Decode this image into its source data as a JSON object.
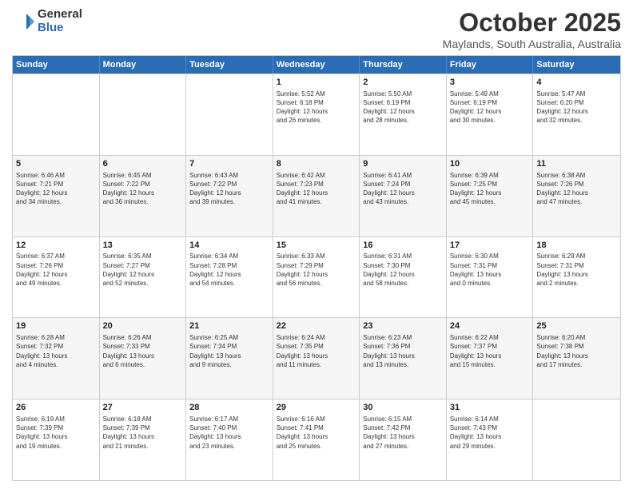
{
  "logo": {
    "general": "General",
    "blue": "Blue"
  },
  "header": {
    "month": "October 2025",
    "location": "Maylands, South Australia, Australia"
  },
  "weekdays": [
    "Sunday",
    "Monday",
    "Tuesday",
    "Wednesday",
    "Thursday",
    "Friday",
    "Saturday"
  ],
  "rows": [
    [
      {
        "day": "",
        "info": ""
      },
      {
        "day": "",
        "info": ""
      },
      {
        "day": "",
        "info": ""
      },
      {
        "day": "1",
        "info": "Sunrise: 5:52 AM\nSunset: 6:18 PM\nDaylight: 12 hours\nand 26 minutes."
      },
      {
        "day": "2",
        "info": "Sunrise: 5:50 AM\nSunset: 6:19 PM\nDaylight: 12 hours\nand 28 minutes."
      },
      {
        "day": "3",
        "info": "Sunrise: 5:49 AM\nSunset: 6:19 PM\nDaylight: 12 hours\nand 30 minutes."
      },
      {
        "day": "4",
        "info": "Sunrise: 5:47 AM\nSunset: 6:20 PM\nDaylight: 12 hours\nand 32 minutes."
      }
    ],
    [
      {
        "day": "5",
        "info": "Sunrise: 6:46 AM\nSunset: 7:21 PM\nDaylight: 12 hours\nand 34 minutes."
      },
      {
        "day": "6",
        "info": "Sunrise: 6:45 AM\nSunset: 7:22 PM\nDaylight: 12 hours\nand 36 minutes."
      },
      {
        "day": "7",
        "info": "Sunrise: 6:43 AM\nSunset: 7:22 PM\nDaylight: 12 hours\nand 39 minutes."
      },
      {
        "day": "8",
        "info": "Sunrise: 6:42 AM\nSunset: 7:23 PM\nDaylight: 12 hours\nand 41 minutes."
      },
      {
        "day": "9",
        "info": "Sunrise: 6:41 AM\nSunset: 7:24 PM\nDaylight: 12 hours\nand 43 minutes."
      },
      {
        "day": "10",
        "info": "Sunrise: 6:39 AM\nSunset: 7:25 PM\nDaylight: 12 hours\nand 45 minutes."
      },
      {
        "day": "11",
        "info": "Sunrise: 6:38 AM\nSunset: 7:26 PM\nDaylight: 12 hours\nand 47 minutes."
      }
    ],
    [
      {
        "day": "12",
        "info": "Sunrise: 6:37 AM\nSunset: 7:26 PM\nDaylight: 12 hours\nand 49 minutes."
      },
      {
        "day": "13",
        "info": "Sunrise: 6:35 AM\nSunset: 7:27 PM\nDaylight: 12 hours\nand 52 minutes."
      },
      {
        "day": "14",
        "info": "Sunrise: 6:34 AM\nSunset: 7:28 PM\nDaylight: 12 hours\nand 54 minutes."
      },
      {
        "day": "15",
        "info": "Sunrise: 6:33 AM\nSunset: 7:29 PM\nDaylight: 12 hours\nand 56 minutes."
      },
      {
        "day": "16",
        "info": "Sunrise: 6:31 AM\nSunset: 7:30 PM\nDaylight: 12 hours\nand 58 minutes."
      },
      {
        "day": "17",
        "info": "Sunrise: 6:30 AM\nSunset: 7:31 PM\nDaylight: 13 hours\nand 0 minutes."
      },
      {
        "day": "18",
        "info": "Sunrise: 6:29 AM\nSunset: 7:31 PM\nDaylight: 13 hours\nand 2 minutes."
      }
    ],
    [
      {
        "day": "19",
        "info": "Sunrise: 6:28 AM\nSunset: 7:32 PM\nDaylight: 13 hours\nand 4 minutes."
      },
      {
        "day": "20",
        "info": "Sunrise: 6:26 AM\nSunset: 7:33 PM\nDaylight: 13 hours\nand 6 minutes."
      },
      {
        "day": "21",
        "info": "Sunrise: 6:25 AM\nSunset: 7:34 PM\nDaylight: 13 hours\nand 9 minutes."
      },
      {
        "day": "22",
        "info": "Sunrise: 6:24 AM\nSunset: 7:35 PM\nDaylight: 13 hours\nand 11 minutes."
      },
      {
        "day": "23",
        "info": "Sunrise: 6:23 AM\nSunset: 7:36 PM\nDaylight: 13 hours\nand 13 minutes."
      },
      {
        "day": "24",
        "info": "Sunrise: 6:22 AM\nSunset: 7:37 PM\nDaylight: 13 hours\nand 15 minutes."
      },
      {
        "day": "25",
        "info": "Sunrise: 6:20 AM\nSunset: 7:38 PM\nDaylight: 13 hours\nand 17 minutes."
      }
    ],
    [
      {
        "day": "26",
        "info": "Sunrise: 6:19 AM\nSunset: 7:39 PM\nDaylight: 13 hours\nand 19 minutes."
      },
      {
        "day": "27",
        "info": "Sunrise: 6:18 AM\nSunset: 7:39 PM\nDaylight: 13 hours\nand 21 minutes."
      },
      {
        "day": "28",
        "info": "Sunrise: 6:17 AM\nSunset: 7:40 PM\nDaylight: 13 hours\nand 23 minutes."
      },
      {
        "day": "29",
        "info": "Sunrise: 6:16 AM\nSunset: 7:41 PM\nDaylight: 13 hours\nand 25 minutes."
      },
      {
        "day": "30",
        "info": "Sunrise: 6:15 AM\nSunset: 7:42 PM\nDaylight: 13 hours\nand 27 minutes."
      },
      {
        "day": "31",
        "info": "Sunrise: 6:14 AM\nSunset: 7:43 PM\nDaylight: 13 hours\nand 29 minutes."
      },
      {
        "day": "",
        "info": ""
      }
    ]
  ]
}
